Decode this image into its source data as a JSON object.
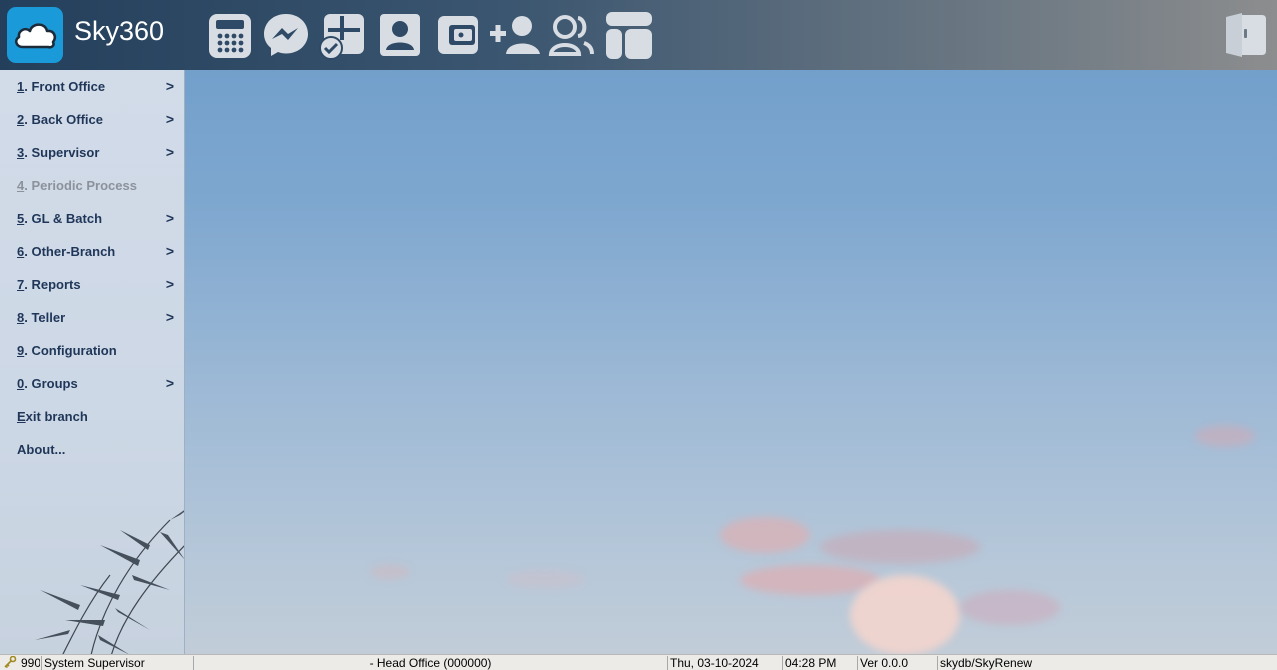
{
  "app": {
    "title": "Sky360"
  },
  "toolbar": {
    "icons": [
      "calculator-icon",
      "messenger-icon",
      "tasks-icon",
      "contact-icon",
      "wallet-icon",
      "add-user-icon",
      "users-icon",
      "layout-icon"
    ],
    "exit_icon": "exit-door-icon"
  },
  "menu": {
    "items": [
      {
        "key": "1",
        "label": ". Front Office",
        "has_submenu": true,
        "arrow": ">"
      },
      {
        "key": "2",
        "label": ". Back Office",
        "has_submenu": true,
        "arrow": ">"
      },
      {
        "key": "3",
        "label": ". Supervisor",
        "has_submenu": true,
        "arrow": ">"
      },
      {
        "key": "4",
        "label": ". Periodic Process",
        "has_submenu": false,
        "disabled": true
      },
      {
        "key": "5",
        "label": ". GL & Batch",
        "has_submenu": true,
        "arrow": ">"
      },
      {
        "key": "6",
        "label": ". Other-Branch",
        "has_submenu": true,
        "arrow": ">"
      },
      {
        "key": "7",
        "label": ". Reports",
        "has_submenu": true,
        "arrow": ">"
      },
      {
        "key": "8",
        "label": ". Teller",
        "has_submenu": true,
        "arrow": ">"
      },
      {
        "key": "9",
        "label": ". Configuration",
        "has_submenu": false
      },
      {
        "key": "0",
        "label": ". Groups",
        "has_submenu": true,
        "arrow": ">"
      },
      {
        "key": "E",
        "label": "xit branch",
        "has_submenu": false
      },
      {
        "key": "",
        "label": "About...",
        "has_submenu": false
      }
    ]
  },
  "status": {
    "code": "990",
    "user": "System Supervisor",
    "branch": "- Head Office (000000)",
    "date": "Thu, 03-10-2024",
    "time": "04:28 PM",
    "version": "Ver 0.0.0",
    "db": "skydb/SkyRenew"
  },
  "colors": {
    "logo_bg": "#1a9ad9",
    "menu_text": "#1f3658",
    "menu_disabled": "#8b929c",
    "icon_fill": "#d8dde3"
  }
}
